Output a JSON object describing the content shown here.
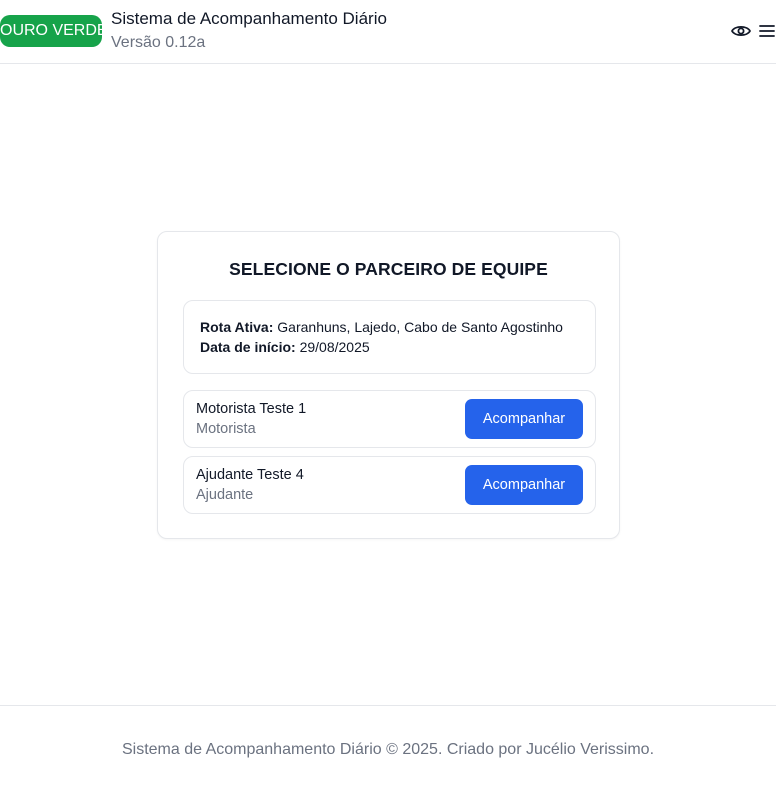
{
  "header": {
    "brand_badge": "OURO VERDE",
    "title": "Sistema de Acompanhamento Diário",
    "version": "Versão 0.12a",
    "icons": [
      "eye-icon",
      "menu-icon"
    ]
  },
  "card": {
    "title": "SELECIONE O PARCEIRO DE EQUIPE",
    "route": {
      "active_label": "Rota Ativa:",
      "active_value": "Garanhuns, Lajedo, Cabo de Santo Agostinho",
      "start_label": "Data de início:",
      "start_value": "29/08/2025"
    },
    "partners": [
      {
        "name": "Motorista Teste 1",
        "role": "Motorista",
        "button_label": "Acompanhar"
      },
      {
        "name": "Ajudante Teste 4",
        "role": "Ajudante",
        "button_label": "Acompanhar"
      }
    ]
  },
  "footer": {
    "text": "Sistema de Acompanhamento Diário © 2025. Criado por Jucélio Verissimo."
  },
  "colors": {
    "brand_green": "#16a34a",
    "primary_blue": "#2563eb",
    "muted_text": "#6b7280",
    "border": "#e5e7eb"
  }
}
